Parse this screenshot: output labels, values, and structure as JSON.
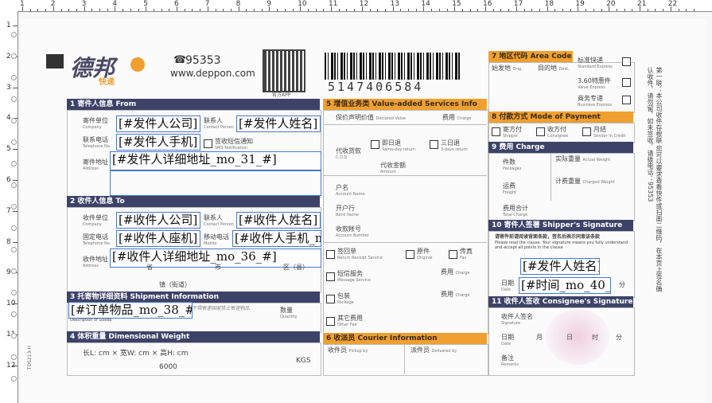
{
  "brand": {
    "name": "德邦",
    "sub": "快递",
    "phone": "95353",
    "website": "www.deppon.com",
    "qr_caption": "官方APP"
  },
  "waybill_number": "5147406584",
  "ruler": {
    "marks": [
      "1",
      "2",
      "3",
      "4",
      "5",
      "6",
      "7",
      "8",
      "9",
      "10",
      "11",
      "12",
      "13",
      "14",
      "15",
      "16",
      "17",
      "18",
      "19",
      "20",
      "21",
      "22"
    ]
  },
  "vruler": {
    "marks": [
      "1",
      "2",
      "3",
      "4",
      "5",
      "6",
      "7",
      "8",
      "9",
      "10",
      "11",
      "12"
    ]
  },
  "side_note": "第一联：本公司收件存根联 您可以要求查看快件或扫面二维码，在本页上签名确认收件，请勿留，如未签收，请拨电话：95353",
  "side_copy_code": "TDS213-H",
  "sec1": {
    "title": "1 寄件人信息 From",
    "company_label": "寄件单位",
    "company_en": "Company",
    "contact_label": "联系人",
    "contact_en": "Contact Person",
    "phone_label": "联系电话",
    "phone_en": "Telephone No.",
    "sms_label": "签收短信通知",
    "sms_en": "SMS Notification",
    "addr_label": "寄件地址",
    "addr_en": "Address",
    "company": "[#发件人公司]",
    "contact": "[#发件人姓名]",
    "phone": "[#发件人手机]",
    "address": "[#发件人详细地址_mo_31_#]"
  },
  "sec2": {
    "title": "2 收件人信息 To",
    "company_label": "收件单位",
    "company_en": "Company",
    "contact_label": "联系人",
    "contact_en": "Contact Person",
    "phone_label": "固定电话",
    "phone_en": "Telephone No.",
    "mobile_label": "移动电话",
    "mobile_en": "Mobile",
    "addr_label": "收件地址",
    "addr_en": "Address",
    "company": "[#收件人公司]",
    "contact": "[#收件人姓名]",
    "phone": "[#收件人座机]",
    "mobile": "[#收件人手机_m",
    "address": "[#收件人详细地址_mo_36_#]",
    "addr_units": [
      "省",
      "市",
      "区（县）",
      "镇（街道）"
    ]
  },
  "sec3": {
    "title": "3 托寄物详细资料 Shipment Information",
    "desc_en": "Description of Goods",
    "goods": "[#订单物品_mo_38_#]",
    "qty_label": "数量",
    "qty_en": "Quantity",
    "note": "不得寄递国家禁止寄递物品"
  },
  "sec4": {
    "title": "4 体积重量 Dimensional Weight",
    "dim_text": "长L:      cm × 宽W:      cm × 高H:      cm",
    "divisor": "6000",
    "kgs": "KGS"
  },
  "sec5": {
    "title": "5 增值业务类 Value-added Services Info",
    "declared": "保价声明价值",
    "declared_en": "Declared Value",
    "fee": "费用",
    "fee_en": "Charge",
    "cod": "代收货款",
    "cod_en": "C.O.D",
    "sameday": "即日退",
    "sameday_en": "Same-day return",
    "threeday": "三日退",
    "threeday_en": "3-days return",
    "amount": "代收金额",
    "amount_en": "Amount",
    "account_name": "户名",
    "account_name_en": "Account Name",
    "bank": "开户行",
    "bank_en": "Bank Name",
    "account_no": "收款帐号",
    "account_no_en": "Account Number",
    "rs": "签回单",
    "rs_en": "Return Receipt Service",
    "original": "原件",
    "original_en": "Original",
    "fax": "传真",
    "fax_en": "Fax",
    "sms": "短信服务",
    "sms_en": "Message Service",
    "package": "包装",
    "package_en": "Package",
    "other": "其它费用",
    "other_en": "Other Fee"
  },
  "sec6": {
    "title": "6 收派员 Courier Information",
    "pickup": "收件员",
    "pickup_en": "Pickup by",
    "delivered": "派件员",
    "delivered_en": "Delivered by"
  },
  "sec7": {
    "title": "7 地区代码 Area Code",
    "origin": "始发地",
    "origin_en": "Orig.",
    "dest": "目的地",
    "dest_en": "Dest.",
    "std": "标准快递",
    "std_en": "Standard Express",
    "p360": "3.60特惠件",
    "p360_en": "Value Express",
    "biz": "商务专递",
    "biz_en": "Business Express"
  },
  "sec8": {
    "title": "8 付款方式 Mode of Payment",
    "shipper": "寄方付",
    "shipper_en": "Shipper",
    "consignee": "收方付",
    "consignee_en": "Consignee",
    "credit": "月结",
    "credit_en": "Sender in Credit"
  },
  "sec9": {
    "title": "9 费用 Charge",
    "packages": "件数",
    "packages_en": "Packages",
    "actual": "实际重量",
    "actual_en": "Actual Weight",
    "freight": "运费",
    "freight_en": "Freight",
    "charged": "计费重量",
    "charged_en": "Charged Weight",
    "total": "费用合计",
    "total_en": "Total Charge"
  },
  "sec10": {
    "title": "10 寄件人签署 Shipper's Signature",
    "clause": "请寄件前请阅读背面条款，签名后表示同意该条款",
    "clause_en": "Please read the clause. Your signature means you fully understand and accept all points in the clause",
    "sig_label": "寄件人签名",
    "date_label": "日期",
    "date_en": "Date",
    "signature": "[#发件人姓名]",
    "time": "[#时间_mo_40_#]",
    "minute": "分"
  },
  "sec11": {
    "title": "11 收件人签收 Consignee's Signature",
    "sig_label": "收件人签名",
    "sig_en": "Signature",
    "date_label": "日期",
    "date_en": "Date",
    "month": "月",
    "day": "日",
    "hour": "时",
    "minute": "分",
    "remarks": "备注",
    "remarks_en": "Remarks"
  },
  "colors": {
    "navy": "#3d4368",
    "orange": "#f0a030",
    "field_border": "#4a78c8"
  }
}
